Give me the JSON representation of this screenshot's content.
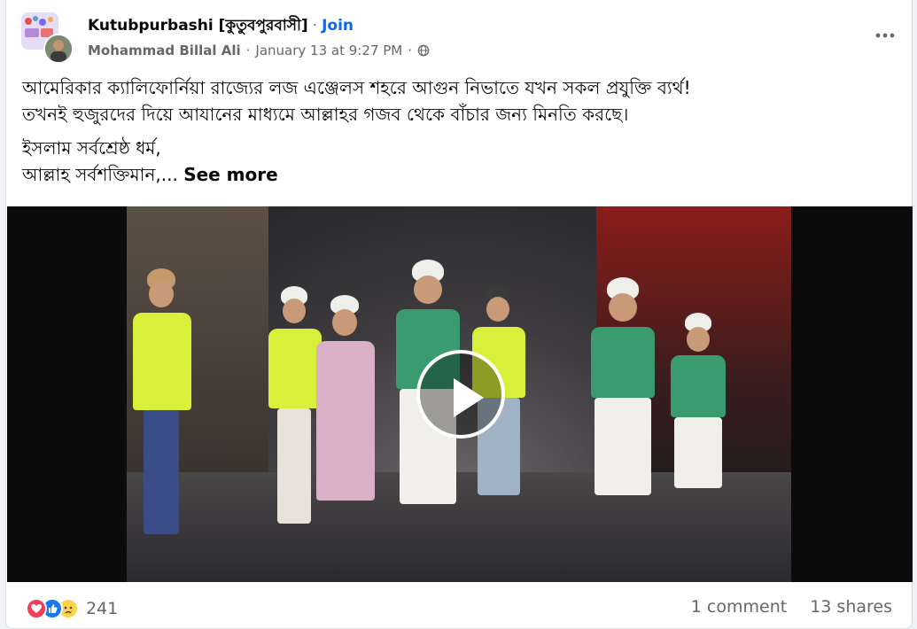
{
  "post": {
    "group_name": "Kutubpurbashi [কুতুবপুরবাসী]",
    "separator": "·",
    "join_label": "Join",
    "author": "Mohammad Billal Ali",
    "date": "January 13 at 9:27 PM",
    "meta_separator": "·",
    "more_icon": "more-horizontal-icon",
    "privacy_icon": "globe-icon"
  },
  "text": {
    "line1": "আমেরিকার ক্যালিফোর্নিয়া রাজ্যের লজ এঞ্জেলস শহরে আগুন নিভাতে যখন সকল প্রযুক্তি ব্যর্থ!",
    "line2": "তখনই হুজুরদের দিয়ে আযানের মাধ্যমে আল্লাহর গজব থেকে বাঁচার জন্য মিনতি করছে।",
    "line3": "ইসলাম সর্বশ্রেষ্ঠ ধর্ম,",
    "line4": "আল্লাহ সর্বশক্তিমান,...",
    "see_more": "See more"
  },
  "video": {
    "play_icon": "play-icon"
  },
  "footer": {
    "reactions": [
      "love",
      "like",
      "sad"
    ],
    "reaction_count": "241",
    "comments": "1 comment",
    "shares": "13 shares"
  },
  "colors": {
    "link_blue": "#0866ff",
    "secondary_text": "#65676b",
    "love": "#f33e58",
    "like": "#1877f2",
    "sad": "#fcd34d"
  }
}
